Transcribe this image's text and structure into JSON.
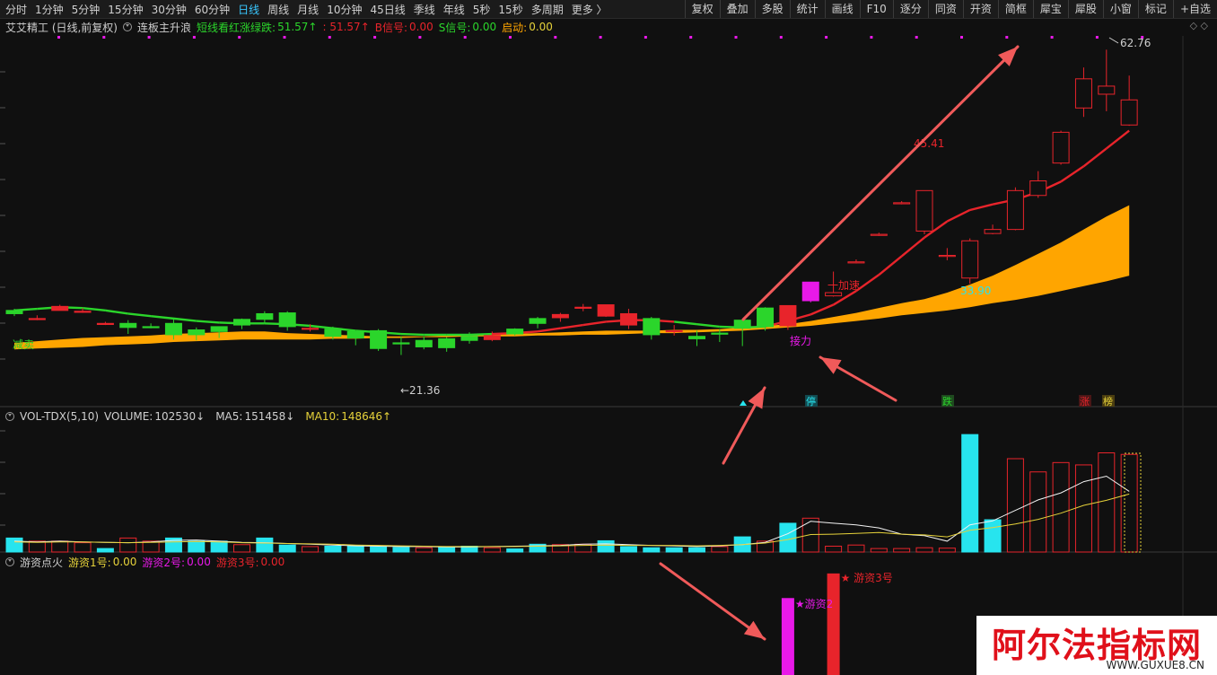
{
  "toolbar": {
    "periods": [
      "分时",
      "1分钟",
      "5分钟",
      "15分钟",
      "30分钟",
      "60分钟",
      "日线",
      "周线",
      "月线",
      "10分钟",
      "45日线",
      "季线",
      "年线",
      "5秒",
      "15秒",
      "多周期",
      "更多 〉"
    ],
    "active_period": "日线",
    "tools": [
      "复权",
      "叠加",
      "多股",
      "统计",
      "画线",
      "F10",
      "逐分",
      "同资",
      "开资",
      "简框",
      "犀宝",
      "犀股",
      "小窗",
      "标记",
      "+自选"
    ]
  },
  "main_panel": {
    "stock_label": "艾艾精工 (日线,前复权)",
    "indicator_name": "连板主升浪",
    "line1_label": "短线看红涨绿跌:",
    "line1_value": "51.57↑",
    "line2_value": ": 51.57↑",
    "b_signal_label": "B信号:",
    "b_signal_value": "0.00",
    "s_signal_label": "S信号:",
    "s_signal_value": "0.00",
    "start_label": "启动:",
    "start_value": "0.00",
    "colors": {
      "red": "#e8242b",
      "green": "#2bd52b",
      "orange": "#ffa500",
      "cyan": "#27e4ee",
      "magenta": "#e919e9",
      "yellow": "#e6d23a"
    }
  },
  "chart_annotations": {
    "high_price": "62.76",
    "level_4541": "45.41",
    "low_after_gap": "33.90",
    "low_price": "21.36",
    "label_reduce": "减卖",
    "label_accelerate": "一加速",
    "label_relay": "接力",
    "tag_stop": "停",
    "tag_drop": "跌",
    "tag_rise": "涨",
    "tag_list": "榜"
  },
  "volume_panel": {
    "name": "VOL-TDX(5,10)",
    "volume_label": "VOLUME:",
    "volume_value": "102530↓",
    "ma5_label": "MA5:",
    "ma5_value": "151458↓",
    "ma10_label": "MA10:",
    "ma10_value": "148646↑"
  },
  "fund_panel": {
    "name": "游资点火",
    "fund1_label": "游资1号:",
    "fund1_value": "0.00",
    "fund2_label": "游资2号:",
    "fund2_value": "0.00",
    "fund3_label": "游资3号:",
    "fund3_value": "0.00",
    "bar2_label": "★游资2",
    "bar3_label": "★ 游资3号"
  },
  "watermark": {
    "title": "阿尔法指标网",
    "url": "WWW.GUXUE8.CN"
  },
  "chart_data": {
    "type": "candlestick",
    "price_ylim": [
      19.5,
      64.5
    ],
    "candles": [
      {
        "o": 30.6,
        "h": 30.8,
        "l": 29.9,
        "c": 30.2,
        "color": "green"
      },
      {
        "o": 29.6,
        "h": 30.0,
        "l": 29.4,
        "c": 29.6,
        "color": "red"
      },
      {
        "o": 31.1,
        "h": 31.3,
        "l": 30.9,
        "c": 30.6,
        "color": "red"
      },
      {
        "o": 30.5,
        "h": 30.9,
        "l": 30.3,
        "c": 30.5,
        "color": "red"
      },
      {
        "o": 29.0,
        "h": 29.2,
        "l": 28.8,
        "c": 29.0,
        "color": "red"
      },
      {
        "o": 28.5,
        "h": 29.4,
        "l": 27.7,
        "c": 29.0,
        "color": "green"
      },
      {
        "o": 28.6,
        "h": 29.0,
        "l": 28.4,
        "c": 28.6,
        "color": "green"
      },
      {
        "o": 27.6,
        "h": 29.7,
        "l": 27.0,
        "c": 29.0,
        "color": "green"
      },
      {
        "o": 27.6,
        "h": 28.5,
        "l": 26.9,
        "c": 28.2,
        "color": "green"
      },
      {
        "o": 28.0,
        "h": 28.6,
        "l": 27.2,
        "c": 28.6,
        "color": "green"
      },
      {
        "o": 28.8,
        "h": 29.6,
        "l": 28.3,
        "c": 29.5,
        "color": "green"
      },
      {
        "o": 29.5,
        "h": 30.5,
        "l": 29.0,
        "c": 30.2,
        "color": "green"
      },
      {
        "o": 28.6,
        "h": 30.5,
        "l": 28.1,
        "c": 30.3,
        "color": "green"
      },
      {
        "o": 28.4,
        "h": 28.9,
        "l": 28.0,
        "c": 28.4,
        "color": "red"
      },
      {
        "o": 27.4,
        "h": 28.6,
        "l": 27.0,
        "c": 28.3,
        "color": "green"
      },
      {
        "o": 27.2,
        "h": 28.0,
        "l": 26.3,
        "c": 28.0,
        "color": "green"
      },
      {
        "o": 25.9,
        "h": 28.3,
        "l": 25.6,
        "c": 28.1,
        "color": "green"
      },
      {
        "o": 26.6,
        "h": 27.4,
        "l": 25.1,
        "c": 26.5,
        "color": "green"
      },
      {
        "o": 26.1,
        "h": 27.4,
        "l": 25.8,
        "c": 26.9,
        "color": "green"
      },
      {
        "o": 26.0,
        "h": 27.3,
        "l": 25.5,
        "c": 27.1,
        "color": "green"
      },
      {
        "o": 26.9,
        "h": 27.9,
        "l": 26.5,
        "c": 27.4,
        "color": "green"
      },
      {
        "o": 27.0,
        "h": 28.0,
        "l": 26.8,
        "c": 27.5,
        "color": "red"
      },
      {
        "o": 27.7,
        "h": 28.4,
        "l": 27.5,
        "c": 28.3,
        "color": "green"
      },
      {
        "o": 29.0,
        "h": 29.8,
        "l": 28.4,
        "c": 29.6,
        "color": "green"
      },
      {
        "o": 29.7,
        "h": 30.3,
        "l": 29.2,
        "c": 30.1,
        "color": "red"
      },
      {
        "o": 30.9,
        "h": 31.4,
        "l": 30.5,
        "c": 31.0,
        "color": "red"
      },
      {
        "o": 31.3,
        "h": 31.3,
        "l": 29.8,
        "c": 29.9,
        "color": "red"
      },
      {
        "o": 28.8,
        "h": 30.8,
        "l": 28.3,
        "c": 30.2,
        "color": "red"
      },
      {
        "o": 27.6,
        "h": 29.8,
        "l": 27.0,
        "c": 29.6,
        "color": "green"
      },
      {
        "o": 28.0,
        "h": 28.8,
        "l": 27.5,
        "c": 28.1,
        "color": "red"
      },
      {
        "o": 27.1,
        "h": 28.1,
        "l": 26.2,
        "c": 27.4,
        "color": "green"
      },
      {
        "o": 27.8,
        "h": 28.3,
        "l": 26.7,
        "c": 27.8,
        "color": "green"
      },
      {
        "o": 29.4,
        "h": 29.4,
        "l": 26.2,
        "c": 28.4,
        "color": "green"
      },
      {
        "o": 28.6,
        "h": 31.0,
        "l": 28.1,
        "c": 30.9,
        "color": "green"
      },
      {
        "o": 28.7,
        "h": 31.2,
        "l": 28.2,
        "c": 31.2,
        "color": "red"
      },
      {
        "o": 31.8,
        "h": 34.1,
        "l": 31.6,
        "c": 34.1,
        "color": "magenta"
      },
      {
        "o": 32.4,
        "h": 35.4,
        "l": 32.3,
        "c": 32.8,
        "color": "red"
      },
      {
        "o": 36.6,
        "h": 36.9,
        "l": 36.4,
        "c": 36.6,
        "color": "red"
      },
      {
        "o": 40.0,
        "h": 40.2,
        "l": 39.8,
        "c": 40.0,
        "color": "red"
      },
      {
        "o": 43.9,
        "h": 44.1,
        "l": 43.7,
        "c": 43.9,
        "color": "red"
      },
      {
        "o": 40.4,
        "h": 45.4,
        "l": 40.0,
        "c": 45.4,
        "color": "red"
      },
      {
        "o": 37.4,
        "h": 38.3,
        "l": 36.8,
        "c": 37.4,
        "color": "red"
      },
      {
        "o": 39.2,
        "h": 39.5,
        "l": 33.9,
        "c": 34.6,
        "color": "red"
      },
      {
        "o": 40.1,
        "h": 41.2,
        "l": 40.0,
        "c": 40.6,
        "color": "red"
      },
      {
        "o": 40.6,
        "h": 45.8,
        "l": 40.5,
        "c": 45.4,
        "color": "red"
      },
      {
        "o": 44.8,
        "h": 47.8,
        "l": 44.5,
        "c": 46.6,
        "color": "red"
      },
      {
        "o": 48.8,
        "h": 52.8,
        "l": 48.6,
        "c": 52.6,
        "color": "red"
      },
      {
        "o": 55.6,
        "h": 60.6,
        "l": 54.5,
        "c": 59.2,
        "color": "red"
      },
      {
        "o": 57.3,
        "h": 62.8,
        "l": 55.2,
        "c": 58.3,
        "color": "red"
      },
      {
        "o": 53.5,
        "h": 59.6,
        "l": 53.4,
        "c": 56.6,
        "color": "red"
      }
    ],
    "line_ma": [
      30.6,
      30.8,
      31.0,
      30.9,
      30.6,
      30.2,
      29.9,
      29.6,
      29.3,
      29.1,
      29.0,
      29.0,
      28.9,
      28.7,
      28.4,
      28.1,
      27.9,
      27.7,
      27.6,
      27.6,
      27.6,
      27.7,
      27.8,
      28.0,
      28.4,
      28.8,
      29.2,
      29.4,
      29.4,
      29.2,
      28.9,
      28.6,
      28.5,
      28.6,
      29.3,
      30.1,
      31.3,
      33.0,
      35.0,
      37.3,
      39.6,
      41.6,
      43.0,
      43.7,
      44.3,
      45.2,
      46.5,
      48.4,
      50.6,
      52.8
    ],
    "band_upper": [
      26.6,
      26.8,
      27.0,
      27.2,
      27.3,
      27.4,
      27.5,
      27.7,
      27.8,
      27.9,
      28.0,
      28.0,
      27.8,
      27.7,
      27.6,
      27.5,
      27.4,
      27.4,
      27.4,
      27.5,
      27.6,
      27.7,
      27.7,
      27.8,
      27.9,
      28.0,
      28.1,
      28.1,
      28.1,
      28.2,
      28.2,
      28.3,
      28.5,
      28.7,
      28.9,
      29.3,
      29.8,
      30.3,
      30.9,
      31.5,
      32.0,
      32.8,
      33.8,
      34.9,
      36.2,
      37.6,
      39.0,
      40.6,
      42.2,
      43.6
    ],
    "band_lower": [
      25.8,
      25.9,
      26.0,
      26.1,
      26.3,
      26.4,
      26.5,
      26.7,
      26.8,
      26.9,
      27.0,
      27.0,
      27.0,
      27.0,
      27.1,
      27.1,
      27.2,
      27.2,
      27.3,
      27.3,
      27.4,
      27.4,
      27.4,
      27.5,
      27.5,
      27.6,
      27.6,
      27.7,
      27.8,
      27.8,
      27.9,
      28.0,
      28.1,
      28.3,
      28.5,
      28.7,
      29.0,
      29.3,
      29.6,
      30.0,
      30.3,
      30.6,
      31.0,
      31.5,
      31.9,
      32.4,
      33.0,
      33.6,
      34.2,
      34.9
    ],
    "volume": [
      36000,
      28000,
      28000,
      24000,
      9000,
      36000,
      28000,
      36000,
      28000,
      28000,
      19000,
      36000,
      18000,
      14000,
      15000,
      16000,
      13000,
      12000,
      11000,
      12000,
      15000,
      11000,
      8000,
      20000,
      19000,
      20000,
      29000,
      14000,
      11000,
      11000,
      11000,
      14000,
      39000,
      28000,
      74000,
      87000,
      15000,
      18000,
      9000,
      9000,
      11000,
      10000,
      302000,
      83000,
      240000,
      206000,
      230000,
      224000,
      255000,
      251000
    ],
    "volume_color": [
      "cyan",
      "red",
      "red",
      "red",
      "cyan",
      "red",
      "red",
      "cyan",
      "cyan",
      "cyan",
      "red",
      "cyan",
      "cyan",
      "red",
      "cyan",
      "cyan",
      "cyan",
      "cyan",
      "red",
      "cyan",
      "cyan",
      "red",
      "cyan",
      "cyan",
      "red",
      "red",
      "cyan",
      "cyan",
      "cyan",
      "cyan",
      "cyan",
      "red",
      "cyan",
      "red",
      "cyan",
      "red",
      "red",
      "red",
      "red",
      "red",
      "red",
      "red",
      "cyan",
      "cyan",
      "red",
      "red",
      "red",
      "red",
      "red",
      "red"
    ],
    "vol_ma5": [
      28000,
      26000,
      28000,
      26000,
      25000,
      24000,
      26000,
      30000,
      31000,
      28000,
      25000,
      24000,
      22000,
      20000,
      18000,
      16000,
      15000,
      14000,
      14000,
      13000,
      13000,
      14000,
      15000,
      16000,
      17000,
      20000,
      21000,
      19000,
      17000,
      16000,
      14000,
      16000,
      19000,
      25000,
      47000,
      79000,
      74000,
      70000,
      62000,
      46000,
      42000,
      28000,
      70000,
      80000,
      107000,
      134000,
      152000,
      181000,
      195000,
      156000
    ],
    "vol_ma10": [
      26000,
      25000,
      26000,
      26000,
      25000,
      24000,
      25000,
      26000,
      27000,
      26000,
      24000,
      23000,
      22000,
      21000,
      20000,
      18000,
      17000,
      16000,
      15000,
      14000,
      14000,
      14000,
      14000,
      15000,
      16000,
      17000,
      18000,
      17000,
      17000,
      17000,
      16000,
      17000,
      19000,
      23000,
      32000,
      45000,
      46000,
      48000,
      50000,
      46000,
      44000,
      39000,
      56000,
      63000,
      72000,
      84000,
      100000,
      120000,
      133000,
      149000
    ],
    "vol_ylim": [
      0,
      330000
    ],
    "fund_bars": [
      {
        "index": 34,
        "value": 1.0,
        "color": "magenta"
      },
      {
        "index": 36,
        "value": 1.32,
        "color": "red"
      }
    ],
    "fund_ylim": [
      0,
      1.4
    ]
  }
}
